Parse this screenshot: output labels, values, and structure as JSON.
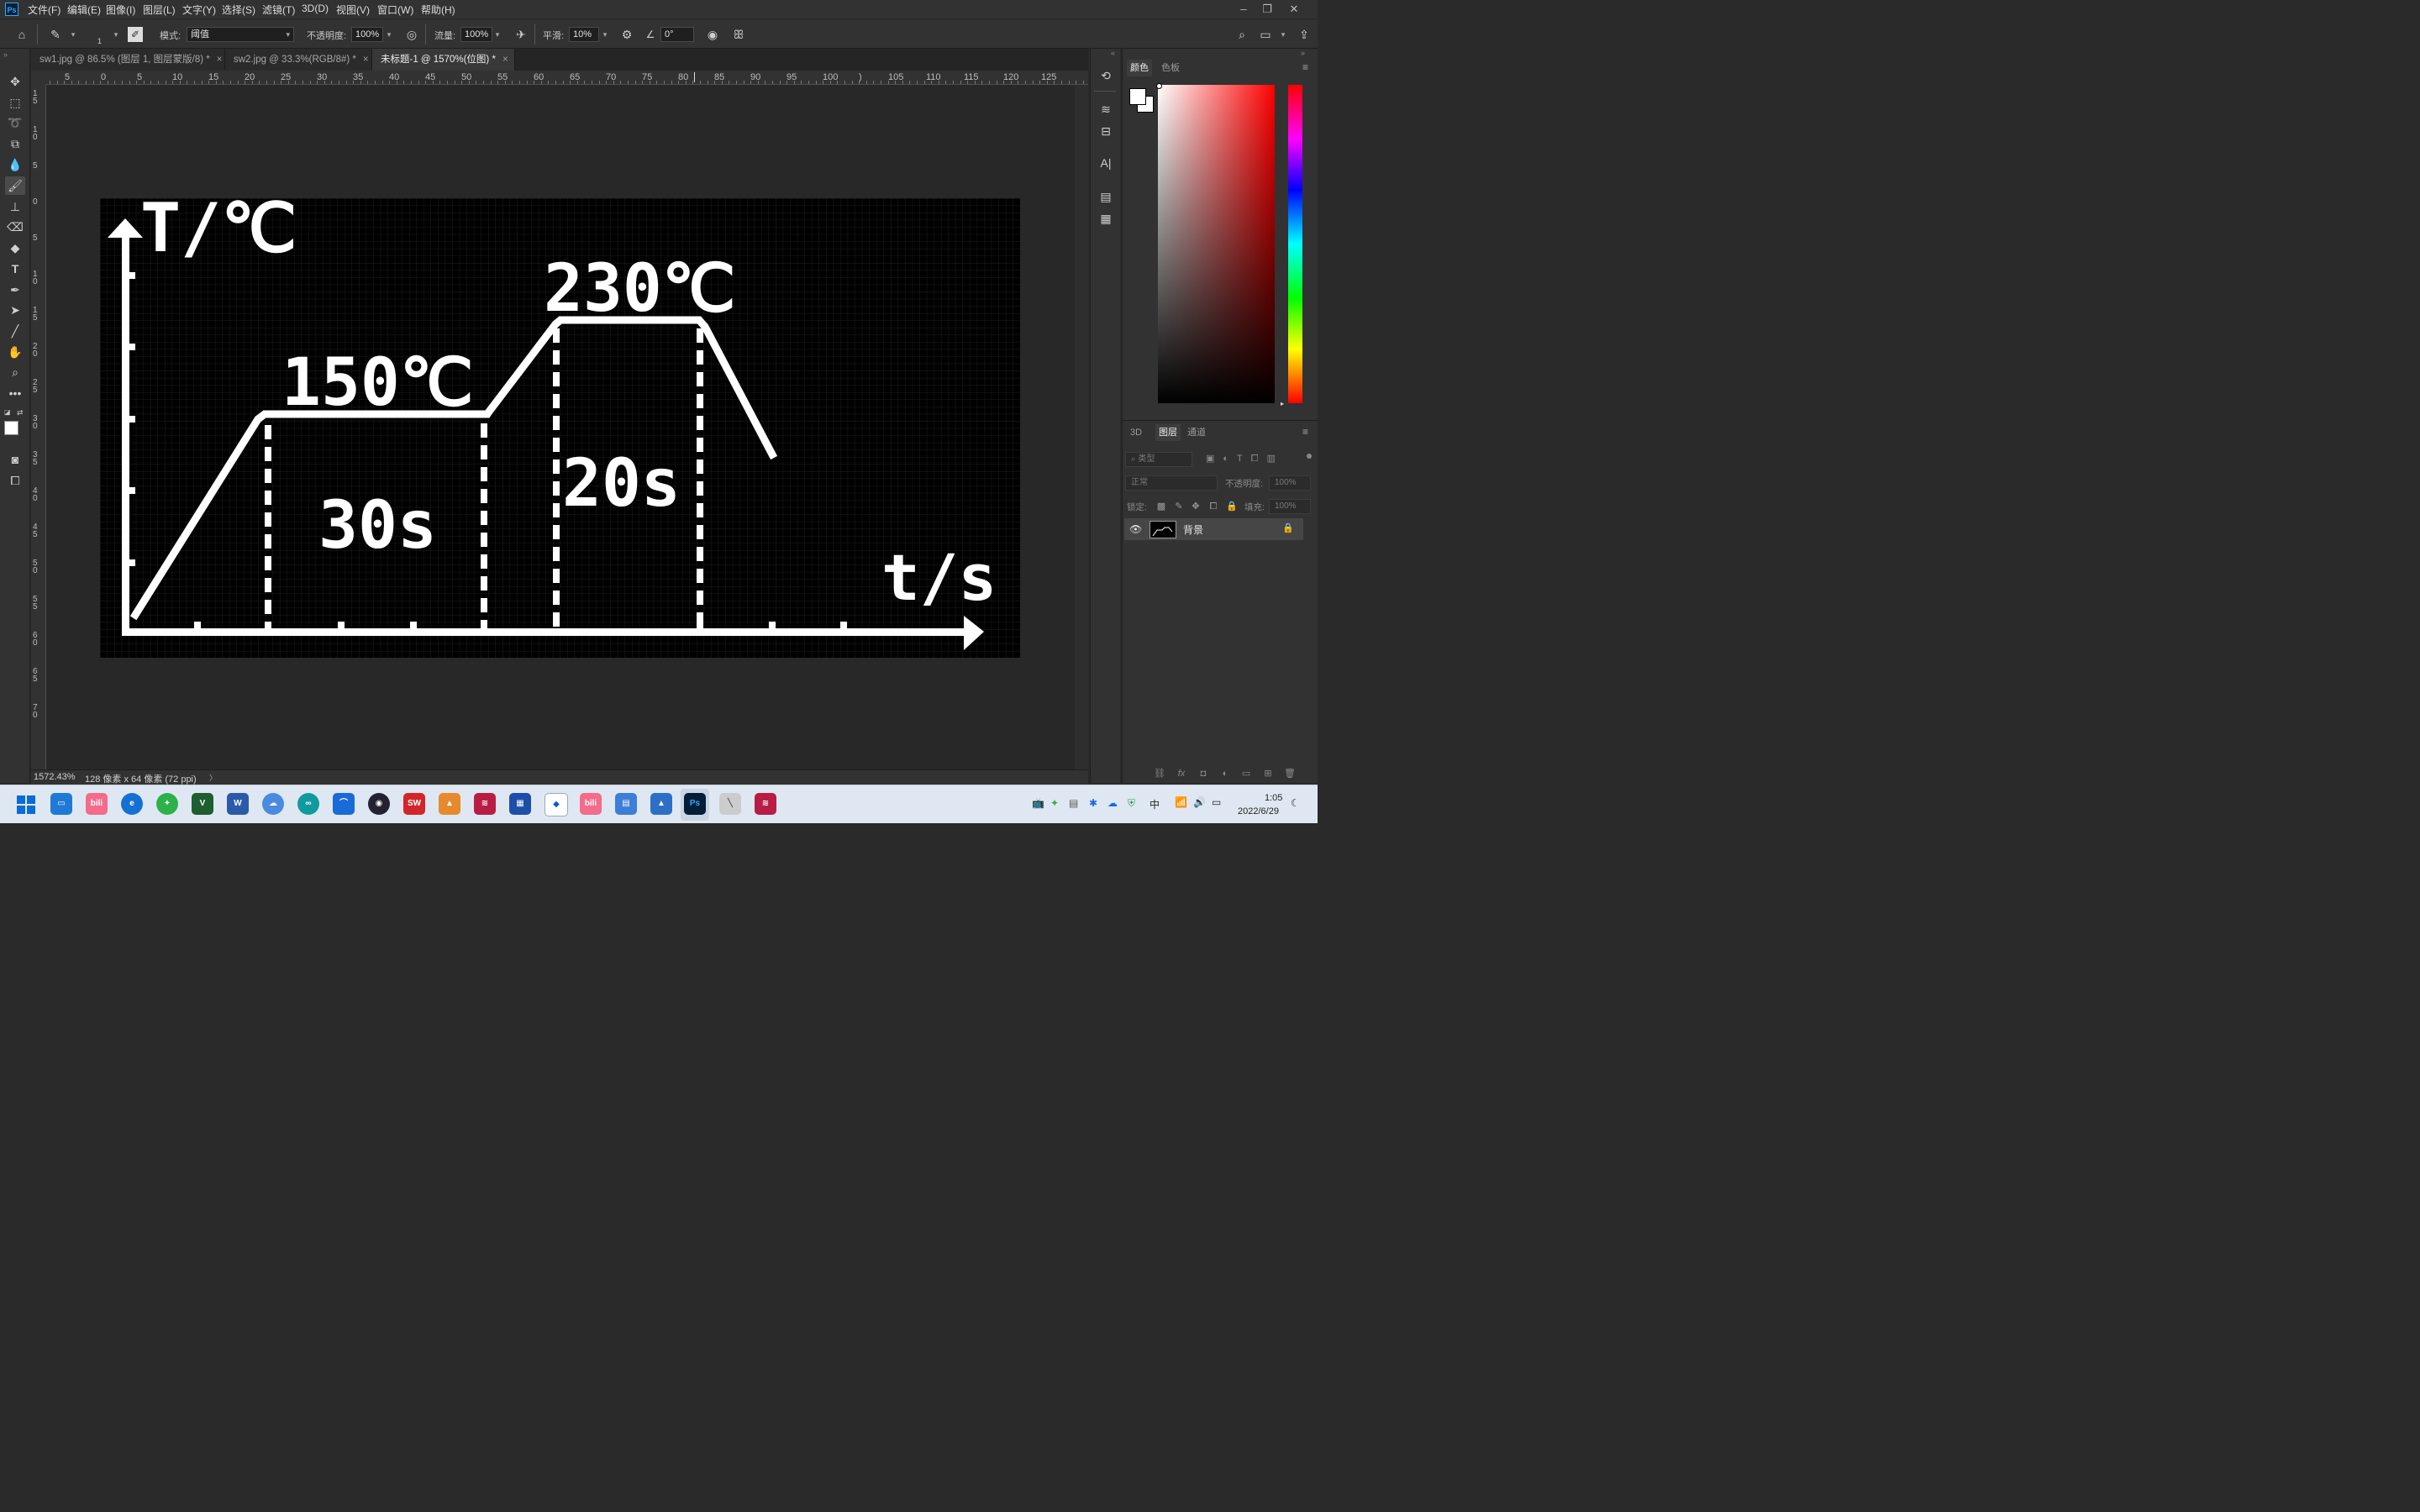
{
  "app": {
    "logo": "Ps",
    "menu": [
      "文件(F)",
      "编辑(E)",
      "图像(I)",
      "图层(L)",
      "文字(Y)",
      "选择(S)",
      "滤镜(T)",
      "3D(D)",
      "视图(V)",
      "窗口(W)",
      "帮助(H)"
    ]
  },
  "options": {
    "brush_size": "1",
    "mode_label": "模式:",
    "mode_value": "阈值",
    "opacity_label": "不透明度:",
    "opacity_value": "100%",
    "flow_label": "流量:",
    "flow_value": "100%",
    "smooth_label": "平滑:",
    "smooth_value": "10%",
    "angle_value": "0°"
  },
  "tabs": [
    {
      "label": "sw1.jpg @ 86.5% (图层 1, 图层蒙版/8) *",
      "close": "×"
    },
    {
      "label": "sw2.jpg @ 33.3%(RGB/8#) *",
      "close": "×"
    },
    {
      "label": "未标题-1 @ 1570%(位图) *",
      "close": "×"
    }
  ],
  "ruler": {
    "h": [
      "5",
      "0",
      "5",
      "10",
      "15",
      "20",
      "25",
      "30",
      "35",
      "40",
      "45",
      "50",
      "55",
      "60",
      "65",
      "70",
      "75",
      "80",
      "85",
      "90",
      "95",
      "100",
      ")",
      "105",
      "110",
      "115",
      "120",
      "125"
    ],
    "v": [
      "15",
      "10",
      "5",
      "0",
      "5",
      "10",
      "15",
      "20",
      "25",
      "30",
      "35",
      "40",
      "45",
      "50",
      "55",
      "60",
      "65",
      "70"
    ]
  },
  "status": {
    "zoom": "1572.43%",
    "doc_info": "128 像素 x 64 像素 (72 ppi)",
    "arrow": "〉"
  },
  "canvas": {
    "y_label": "T/℃",
    "x_label": "t/s",
    "label_150": "150℃",
    "label_230": "230℃",
    "label_30s": "30s",
    "label_20s": "20s"
  },
  "panels": {
    "color_tab": "颜色",
    "swatches_tab": "色板",
    "tab_3d": "3D",
    "layers_tab": "图层",
    "channels_tab": "通道",
    "kind_placeholder": "类型",
    "blend_mode": "正常",
    "opacity_label": "不透明度:",
    "opacity_value": "100%",
    "lock_label": "锁定:",
    "fill_label": "填充:",
    "fill_value": "100%",
    "layer_name": "背景"
  },
  "taskbar": {
    "time": "1:05",
    "date": "2022/6/29",
    "ime": "中"
  }
}
